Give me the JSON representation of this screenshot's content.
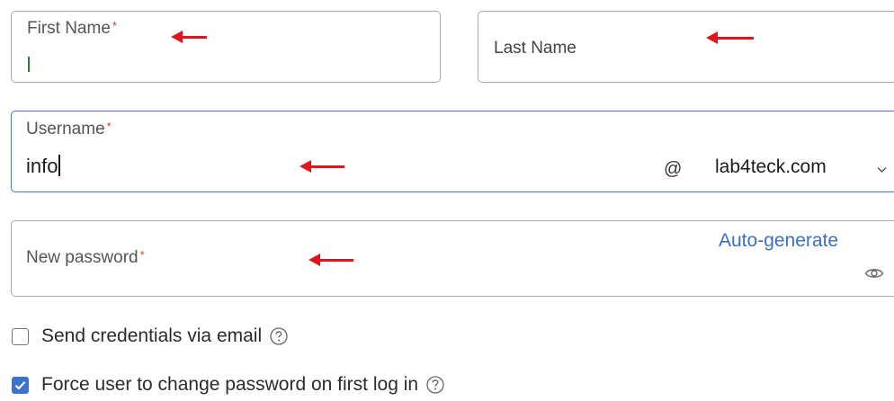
{
  "first_name": {
    "label": "First Name",
    "required_mark": "*",
    "value": ""
  },
  "last_name": {
    "label": "Last Name"
  },
  "username": {
    "label": "Username",
    "required_mark": "*",
    "value": "info",
    "at_symbol": "@",
    "domain": "lab4teck.com",
    "domain_dropdown_icon": "chevron-down-icon"
  },
  "new_password": {
    "label": "New password",
    "required_mark": "*",
    "auto_generate_label": "Auto-generate",
    "visibility_icon": "eye-icon"
  },
  "options": {
    "send_credentials": {
      "label": "Send credentials via email",
      "checked": false,
      "help_icon": "help-icon"
    },
    "force_change": {
      "label": "Force user to change password on first log in",
      "checked": true,
      "help_icon": "help-icon"
    }
  },
  "colors": {
    "annotation_arrow": "#e0141a",
    "focus_border": "#4a73c9",
    "link": "#3a6fc4",
    "required_asterisk": "#d23a3a",
    "checkbox_checked": "#3b72cf"
  }
}
